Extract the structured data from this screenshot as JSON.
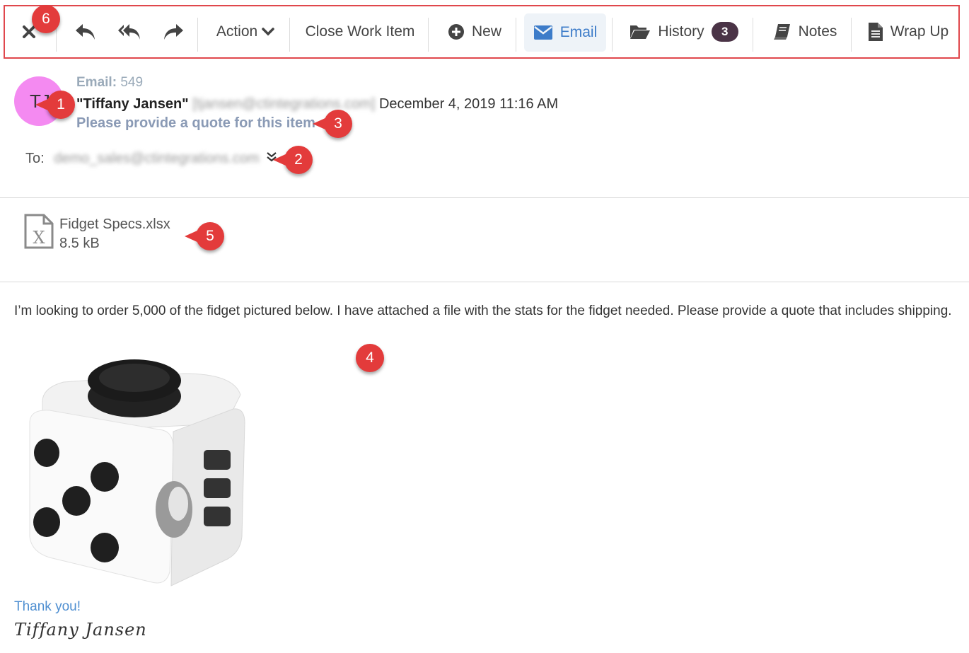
{
  "toolbar": {
    "close_icon": "close-icon",
    "reply_icon": "reply-icon",
    "reply_all_icon": "reply-all-icon",
    "forward_icon": "forward-icon",
    "action_label": "Action",
    "close_work_item_label": "Close Work Item",
    "new_label": "New",
    "email_label": "Email",
    "history_label": "History",
    "history_count": "3",
    "notes_label": "Notes",
    "wrap_up_label": "Wrap Up",
    "accent": "#3d7cc9",
    "highlight_border": "#e0474c"
  },
  "header": {
    "avatar_initials": "TJ",
    "avatar_color": "#f48af1",
    "email_label": "Email:",
    "email_number": "549",
    "sender_name": "\"Tiffany Jansen\"",
    "sender_address": "[tjansen@ctintegrations.com]",
    "date": "December 4, 2019 11:16 AM",
    "subject": "Please provide a quote for this item",
    "to_label": "To:",
    "to_address": "demo_sales@ctintegrations.com"
  },
  "attachment": {
    "icon": "excel-file-icon",
    "name": "Fidget Specs.xlsx",
    "size": "8.5 kB"
  },
  "body": {
    "text": "I’m looking to order 5,000 of the fidget pictured below. I have attached a file with the stats for the fidget needed. Please provide a quote that includes shipping.",
    "thanks": "Thank you!",
    "signature": "Tiffany Jansen"
  },
  "callouts": {
    "c1": "1",
    "c2": "2",
    "c3": "3",
    "c4": "4",
    "c5": "5",
    "c6": "6",
    "color": "#e33b3b"
  }
}
